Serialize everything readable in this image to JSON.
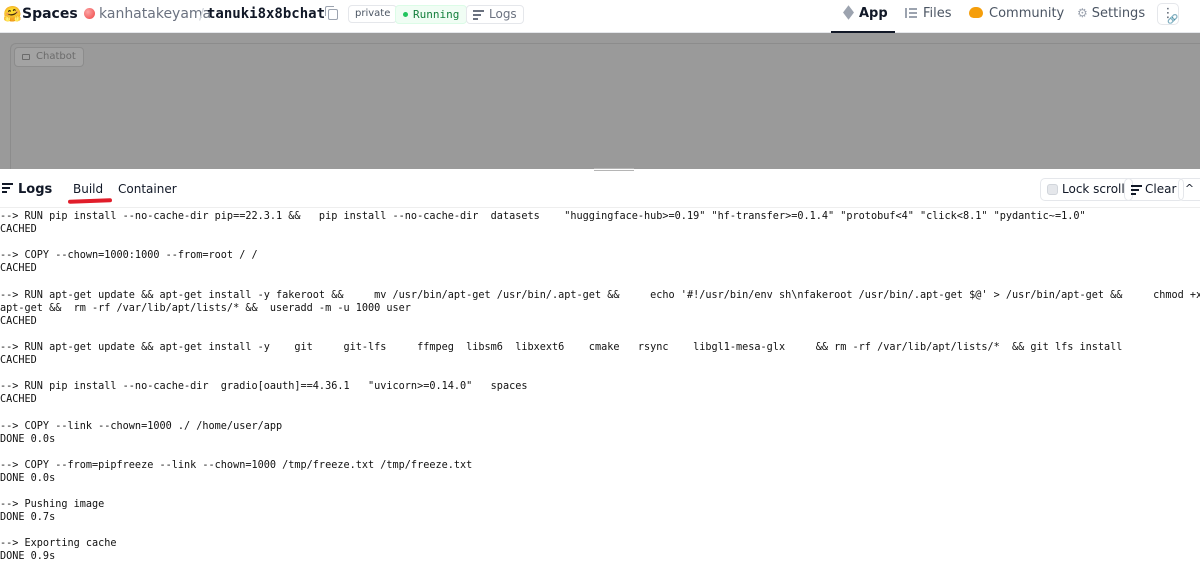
{
  "header": {
    "logo": "🤗",
    "brand": "Spaces",
    "owner": "kanhatakeyama",
    "separator": "/",
    "repo": "tanuki8x8bchat",
    "visibility": "private",
    "status": "Running",
    "logs_link": "Logs",
    "nav": {
      "app": "App",
      "files": "Files",
      "community": "Community",
      "settings": "Settings",
      "menu": "⋮"
    }
  },
  "preview": {
    "chatbot_label": "Chatbot"
  },
  "logs": {
    "title": "Logs",
    "tabs": {
      "build": "Build",
      "container": "Container"
    },
    "lock_scroll": "Lock scroll",
    "clear": "Clear",
    "collapse": "^",
    "lines": [
      "--> RUN pip install --no-cache-dir pip==22.3.1 &&   pip install --no-cache-dir  datasets    \"huggingface-hub>=0.19\" \"hf-transfer>=0.1.4\" \"protobuf<4\" \"click<8.1\" \"pydantic~=1.0\"",
      "CACHED",
      "",
      "--> COPY --chown=1000:1000 --from=root / /",
      "CACHED",
      "",
      "--> RUN apt-get update && apt-get install -y fakeroot &&     mv /usr/bin/apt-get /usr/bin/.apt-get &&     echo '#!/usr/bin/env sh\\nfakeroot /usr/bin/.apt-get $@' > /usr/bin/apt-get &&     chmod +x /usr/bin/apt-get &&  rm -rf /var/lib/apt/lists/* &&  useradd -m -u 1000 user",
      "apt-get &&  rm -rf /var/lib/apt/lists/* &&  useradd -m -u 1000 user",
      "CACHED",
      "",
      "--> RUN apt-get update && apt-get install -y    git     git-lfs     ffmpeg  libsm6  libxext6    cmake   rsync    libgl1-mesa-glx     && rm -rf /var/lib/apt/lists/*  && git lfs install",
      "CACHED",
      "",
      "--> RUN pip install --no-cache-dir  gradio[oauth]==4.36.1   \"uvicorn>=0.14.0\"   spaces",
      "CACHED",
      "",
      "--> COPY --link --chown=1000 ./ /home/user/app",
      "DONE 0.0s",
      "",
      "--> COPY --from=pipfreeze --link --chown=1000 /tmp/freeze.txt /tmp/freeze.txt",
      "DONE 0.0s",
      "",
      "--> Pushing image",
      "DONE 0.7s",
      "",
      "--> Exporting cache",
      "DONE 0.9s"
    ]
  }
}
